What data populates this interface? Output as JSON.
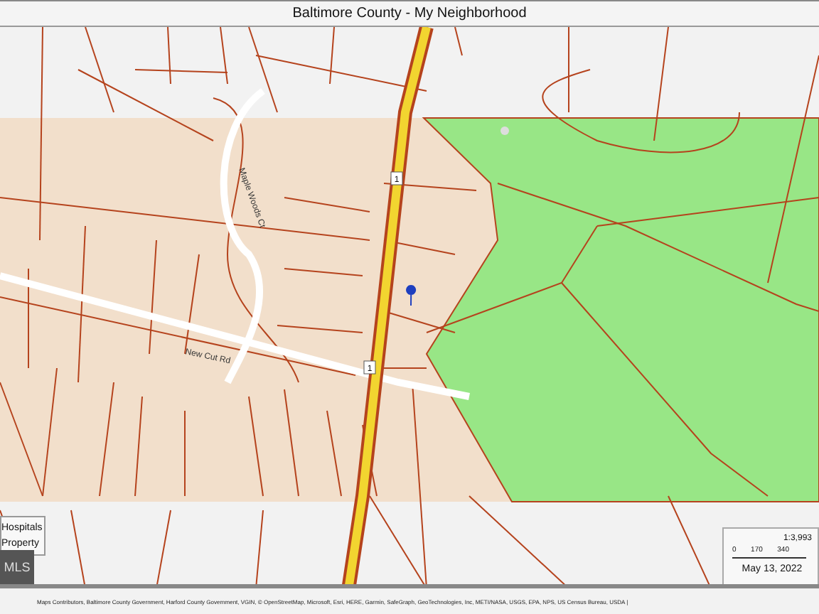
{
  "window": {
    "title": "Baltimore County - My Neighborhood"
  },
  "map": {
    "street_labels": [
      {
        "text": "New Cut Rd",
        "kind": "street"
      },
      {
        "text": "Maple Woods Ct",
        "kind": "street"
      },
      {
        "text": "1",
        "kind": "shield"
      },
      {
        "text": "1",
        "kind": "shield"
      }
    ]
  },
  "legend": {
    "items": [
      "Hospitals",
      "Property"
    ]
  },
  "logo": "MLS",
  "scale": {
    "ratio": "1:3,993",
    "ticks": [
      "0",
      "170",
      "340"
    ],
    "date": "May 13, 2022"
  },
  "attribution": "Maps Contributors, Baltimore County Government, Harford County Government, VGIN, © OpenStreetMap, Microsoft, Esri, HERE, Garmin, SafeGraph, GeoTechnologies, Inc, METI/NASA, USGS, EPA, NPS, US Census Bureau, USDA |"
}
